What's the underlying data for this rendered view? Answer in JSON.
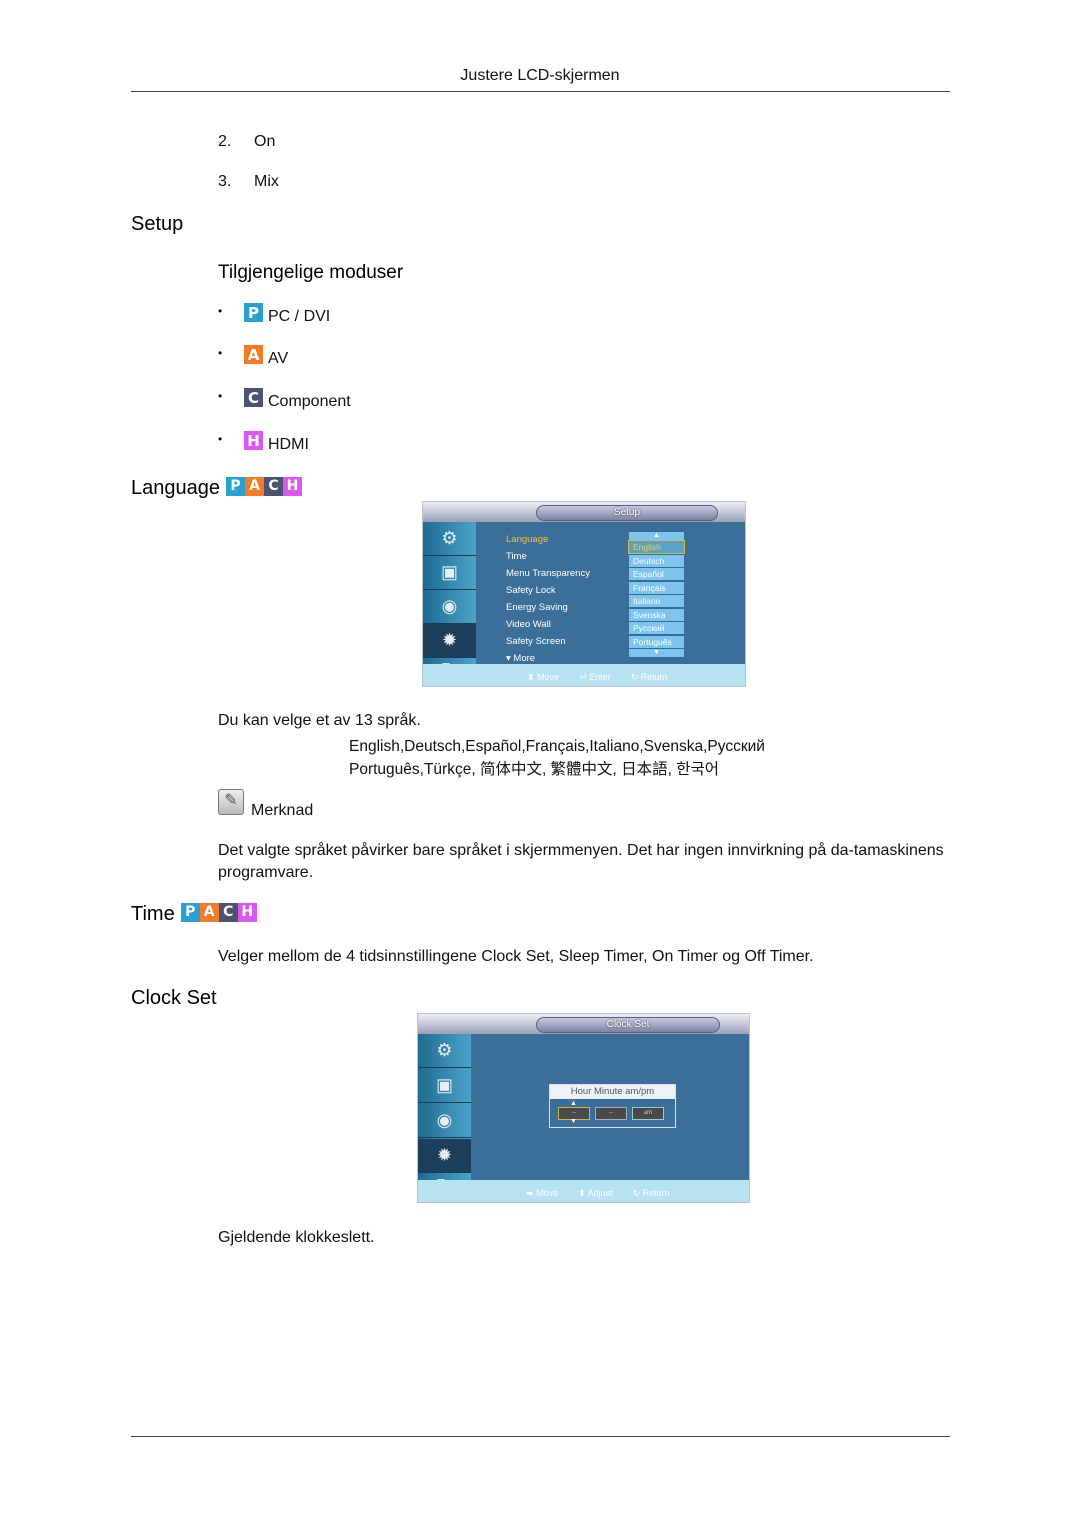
{
  "header": {
    "title": "Justere LCD-skjermen"
  },
  "numbered_items": [
    {
      "num": "2.",
      "label": "On"
    },
    {
      "num": "3.",
      "label": "Mix"
    }
  ],
  "setup": {
    "heading": "Setup",
    "subheading": "Tilgjengelige moduser",
    "modes": [
      {
        "badge": "P",
        "label": "PC / DVI",
        "color": "#2a9fd0"
      },
      {
        "badge": "A",
        "label": "AV",
        "color": "#f07c28"
      },
      {
        "badge": "C",
        "label": "Component",
        "color": "#4a5370"
      },
      {
        "badge": "H",
        "label": "HDMI",
        "color": "#d858f0"
      }
    ]
  },
  "pach": [
    "P",
    "A",
    "C",
    "H"
  ],
  "language": {
    "heading": "Language",
    "osd": {
      "title": "Setup",
      "menu_items": [
        "Language",
        "Time",
        "Menu Transparency",
        "Safety Lock",
        "Energy Saving",
        "Video Wall",
        "Safety Screen"
      ],
      "more_label": "More",
      "options": [
        "English",
        "Deutsch",
        "Español",
        "Français",
        "Italiano",
        "Svenska",
        "Русский",
        "Português"
      ],
      "selected_option": "English",
      "footer": {
        "move": "Move",
        "enter": "Enter",
        "return": "Return"
      }
    },
    "intro": "Du kan velge et av 13 språk.",
    "languages_line1": "English,Deutsch,Español,Français,Italiano,Svenska,Русский",
    "languages_line2": "Português,Türkçe, 简体中文,  繁體中文, 日本語, 한국어",
    "note_label": "Merknad",
    "note_text": "Det valgte språket påvirker bare språket i skjermmenyen. Det har ingen innvirkning på da-tamaskinens programvare."
  },
  "time": {
    "heading": "Time",
    "text_prefix": "Velger mellom de 4 tidsinnstillingene ",
    "opt1": "Clock Set",
    "sep1": ", ",
    "opt2": "Sleep Timer",
    "sep2": ", ",
    "opt3": "On Timer",
    "sep3": " og ",
    "opt4": "Off Timer",
    "suffix": "."
  },
  "clock_set": {
    "heading": "Clock Set",
    "osd": {
      "title": "Clock Set",
      "fields_header": "Hour  Minute  am/pm",
      "hour": "--",
      "minute": "--",
      "ampm": "am",
      "footer": {
        "move": "Move",
        "adjust": "Adjust",
        "return": "Return"
      }
    },
    "caption": "Gjeldende klokkeslett."
  }
}
